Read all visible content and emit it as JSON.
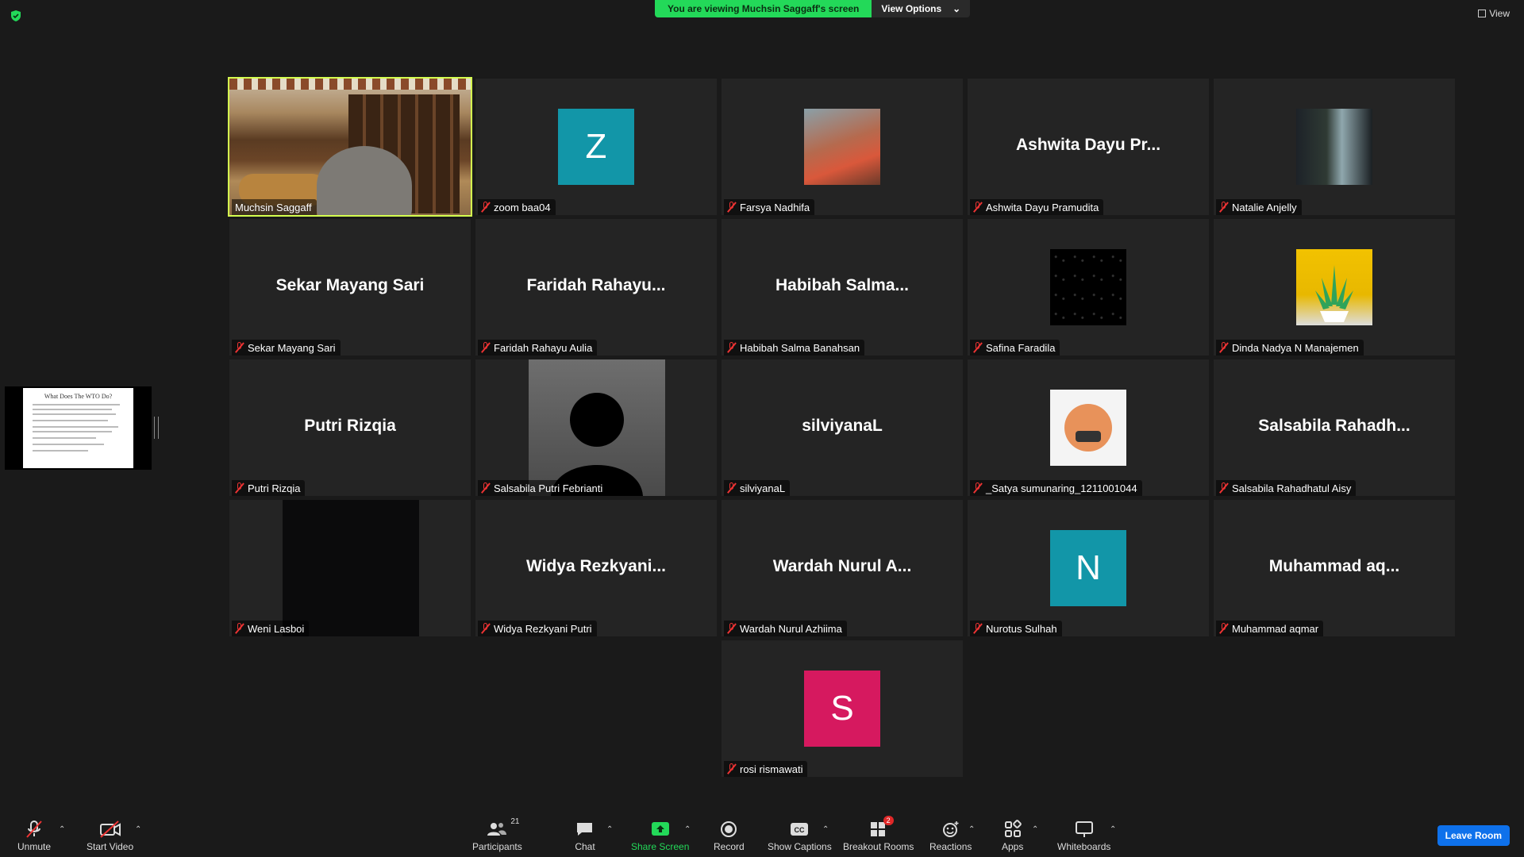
{
  "banner": {
    "message": "You are viewing Muchsin Saggaff's screen",
    "view_options": "View Options"
  },
  "top_right": {
    "view_label": "View"
  },
  "shared_slide": {
    "title": "What Does The WTO Do?"
  },
  "colors": {
    "active_border": "#d4ff4f",
    "banner_green": "#23d959",
    "leave_blue": "#0e71eb",
    "mute_red": "#e33333"
  },
  "participants": [
    {
      "name": "Muchsin Saggaff",
      "display": "video",
      "active": true
    },
    {
      "name": "zoom baa04",
      "display": "avatar",
      "letter": "Z",
      "color": "#1296a8"
    },
    {
      "name": "Farsya Nadhifa",
      "display": "photo"
    },
    {
      "name": "Ashwita Dayu Pramudita",
      "display": "text",
      "big": "Ashwita Dayu Pr..."
    },
    {
      "name": "Natalie Anjelly",
      "display": "photo"
    },
    {
      "name": "Sekar Mayang Sari",
      "display": "text",
      "big": "Sekar Mayang Sari"
    },
    {
      "name": "Faridah Rahayu Aulia",
      "display": "text",
      "big": "Faridah  Rahayu..."
    },
    {
      "name": "Habibah Salma Banahsan",
      "display": "text",
      "big": "Habibah  Salma..."
    },
    {
      "name": "Safina Faradila",
      "display": "photo"
    },
    {
      "name": "Dinda Nadya N Manajemen",
      "display": "photo"
    },
    {
      "name": "Putri Rizqia",
      "display": "text",
      "big": "Putri Rizqia"
    },
    {
      "name": "Salsabila Putri Febrianti",
      "display": "video"
    },
    {
      "name": "silviyanaL",
      "display": "text",
      "big": "silviyanaL"
    },
    {
      "name": "_Satya sumunaring_1211001044",
      "display": "photo"
    },
    {
      "name": "Salsabila Rahadhatul Aisy",
      "display": "text",
      "big": "Salsabila  Rahadh..."
    },
    {
      "name": "Weni Lasboi",
      "display": "video"
    },
    {
      "name": "Widya Rezkyani Putri",
      "display": "text",
      "big": "Widya  Rezkyani..."
    },
    {
      "name": "Wardah Nurul Azhiima",
      "display": "text",
      "big": "Wardah  Nurul  A..."
    },
    {
      "name": "Nurotus Sulhah",
      "display": "avatar",
      "letter": "N",
      "color": "#1296a8"
    },
    {
      "name": "Muhammad aqmar",
      "display": "text",
      "big": "Muhammad  aq..."
    },
    {
      "name": "rosi rismawati",
      "display": "avatar",
      "letter": "S",
      "color": "#d6195f"
    }
  ],
  "toolbar": {
    "unmute": "Unmute",
    "start_video": "Start Video",
    "participants": "Participants",
    "participants_count": "21",
    "chat": "Chat",
    "share_screen": "Share Screen",
    "record": "Record",
    "show_captions": "Show Captions",
    "breakout_rooms": "Breakout Rooms",
    "breakout_badge": "2",
    "reactions": "Reactions",
    "apps": "Apps",
    "whiteboards": "Whiteboards",
    "leave_room": "Leave Room"
  }
}
